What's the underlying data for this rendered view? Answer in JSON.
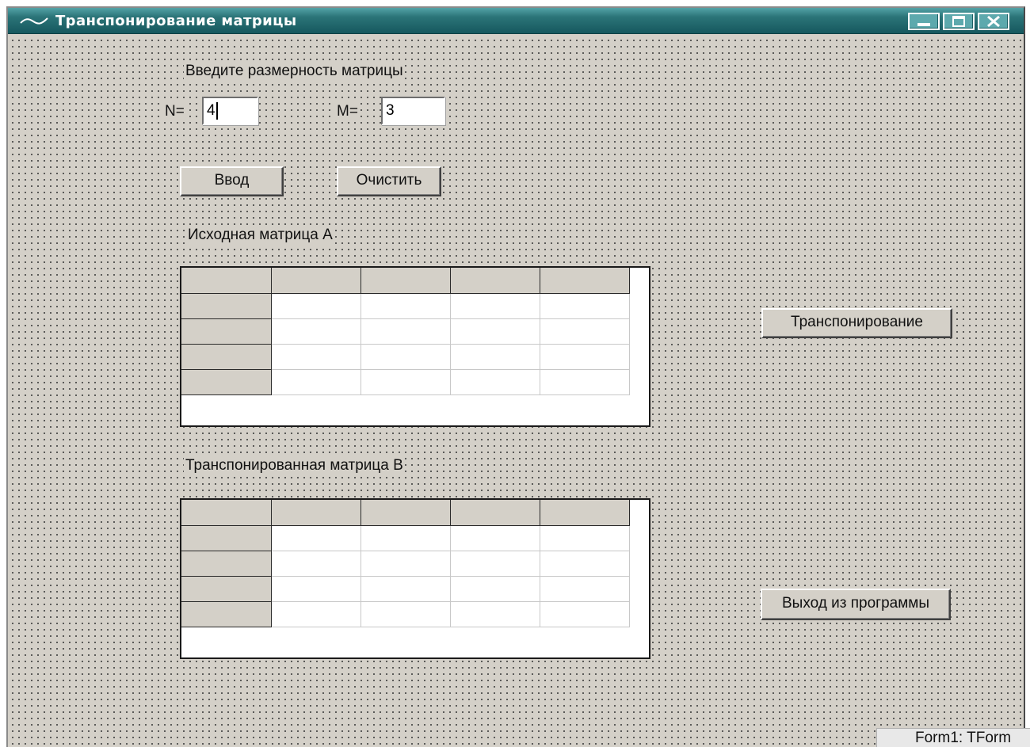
{
  "window": {
    "title": "Транспонирование матрицы",
    "icon": "tilde-wave-icon",
    "controls": [
      "minimize-icon",
      "maximize-icon",
      "close-icon"
    ]
  },
  "form": {
    "prompt_label": "Введите размерность матрицы",
    "n_label": "N=",
    "n_value": "4",
    "m_label": "M=",
    "m_value": "3",
    "enter_button": "Ввод",
    "clear_button": "Очистить",
    "matrix_a_label": "Исходная матрица A",
    "matrix_b_label": "Транспонированная матрица B",
    "transpose_button": "Транспонирование",
    "exit_button": "Выход из программы"
  },
  "grids": {
    "matrix_a": {
      "rows": 5,
      "cols": 5,
      "fixed_rows": 1,
      "fixed_cols": 1
    },
    "matrix_b": {
      "rows": 5,
      "cols": 5,
      "fixed_rows": 1,
      "fixed_cols": 1
    }
  },
  "status": {
    "text": "Form1: TForm"
  },
  "colors": {
    "titlebar": "#2b7478",
    "form_bg": "#d4d0c8",
    "grid_fixed": "#d4d0c8"
  }
}
